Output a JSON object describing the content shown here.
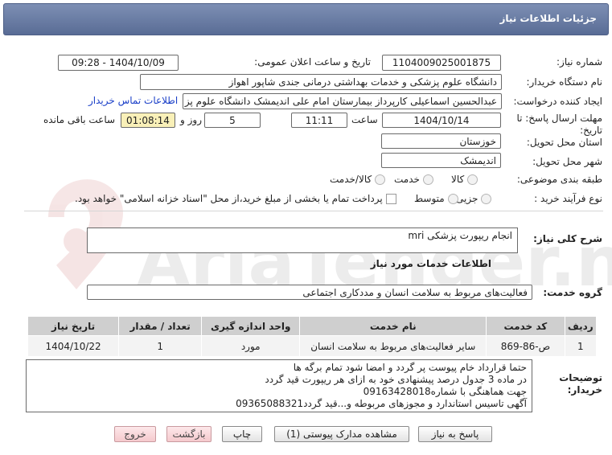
{
  "header": {
    "title": "جزئیات اطلاعات نیاز"
  },
  "form": {
    "need_number": {
      "label": "شماره نیاز:",
      "value": "1104009025001875"
    },
    "announce_datetime": {
      "label": "تاریخ و ساعت اعلان عمومی:",
      "value": "1404/10/09 - 09:28"
    },
    "buyer_org": {
      "label": "نام دستگاه خریدار:",
      "value": "دانشگاه علوم پزشکی و خدمات بهداشتی درمانی جندی شاپور اهواز"
    },
    "requester": {
      "label": "ایجاد کننده درخواست:",
      "value": "عبدالحسین اسماعیلی کارپرداز بیمارستان امام علی اندیمشک دانشگاه علوم پز",
      "contact_link": "اطلاعات تماس خریدار"
    },
    "deadline": {
      "label_line1": "مهلت ارسال پاسخ: تا",
      "label_line2": "تاریخ:",
      "date": "1404/10/14",
      "time_label": "ساعت",
      "time": "11:11",
      "days": "5",
      "days_label": "روز و",
      "remaining": "01:08:14",
      "remaining_label": "ساعت باقی مانده"
    },
    "province": {
      "label": "استان محل تحویل:",
      "value": "خوزستان"
    },
    "city": {
      "label": "شهر محل تحویل:",
      "value": "اندیمشک"
    },
    "category": {
      "label": "طبقه بندی موضوعی:",
      "options": [
        "کالا",
        "خدمت",
        "کالا/خدمت"
      ]
    },
    "process": {
      "label": "نوع فرآیند خرید :",
      "options": [
        "جزیی",
        "متوسط"
      ],
      "payment_note": "پرداخت تمام یا بخشی از مبلغ خرید،از محل \"اسناد خزانه اسلامی\" خواهد بود."
    },
    "summary": {
      "label": "شرح کلی نیاز:",
      "value": "انجام ریپورت پزشکی mri"
    }
  },
  "services": {
    "section_title": "اطلاعات خدمات مورد نیاز",
    "group_label": "گروه خدمت:",
    "group_value": "فعالیت‌های مربوط به سلامت انسان و مددکاری اجتماعی",
    "table": {
      "headers": [
        "ردیف",
        "کد خدمت",
        "نام خدمت",
        "واحد اندازه گیری",
        "تعداد / مقدار",
        "تاریخ نیاز"
      ],
      "rows": [
        [
          "1",
          "ص-86-869",
          "سایر فعالیت‌های مربوط به سلامت انسان",
          "مورد",
          "1",
          "1404/10/22"
        ]
      ]
    }
  },
  "buyer_notes": {
    "label_line1": "توضیحات",
    "label_line2": "خریدار:",
    "lines": [
      "حتما قرارداد خام پیوست پر گردد و امضا شود تمام برگه ها",
      "در ماده 3 جدول درصد پیشنهادی خود به ازای هر ریپورت قید گردد",
      "جهت هماهنگی با شماره09163428018",
      "آگهی تاسیس استاندارد و مجوزهای مربوطه و...قید گردد09365088321"
    ]
  },
  "buttons": {
    "reply": "پاسخ به نیاز",
    "view_docs": "مشاهده مدارک پیوستی (1)",
    "print": "چاپ",
    "back": "بازگشت",
    "exit": "خروج"
  },
  "watermark": {
    "text": "AriaTender.net"
  }
}
